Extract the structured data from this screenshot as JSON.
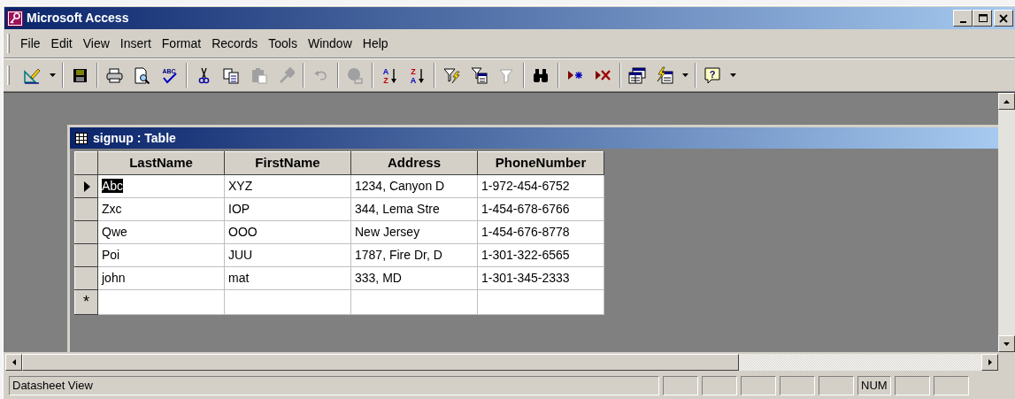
{
  "window": {
    "title": "Microsoft Access"
  },
  "menu": [
    {
      "label": "File"
    },
    {
      "label": "Edit"
    },
    {
      "label": "View"
    },
    {
      "label": "Insert"
    },
    {
      "label": "Format"
    },
    {
      "label": "Records"
    },
    {
      "label": "Tools"
    },
    {
      "label": "Window"
    },
    {
      "label": "Help"
    }
  ],
  "toolbar": {
    "groups": [
      [
        {
          "kind": "view",
          "disabled": false,
          "dropdown": true
        }
      ],
      [
        {
          "kind": "save",
          "disabled": false,
          "dropdown": false
        }
      ],
      [
        {
          "kind": "print",
          "disabled": false,
          "dropdown": false
        },
        {
          "kind": "preview",
          "disabled": false,
          "dropdown": false
        },
        {
          "kind": "spelling",
          "disabled": false,
          "dropdown": false,
          "glyphs": [
            "ABC"
          ]
        }
      ],
      [
        {
          "kind": "cut",
          "disabled": false,
          "dropdown": false
        },
        {
          "kind": "copy",
          "disabled": false,
          "dropdown": false
        },
        {
          "kind": "paste",
          "disabled": true,
          "dropdown": false
        },
        {
          "kind": "format_painter",
          "disabled": true,
          "dropdown": false
        }
      ],
      [
        {
          "kind": "undo",
          "disabled": true,
          "dropdown": false
        }
      ],
      [
        {
          "kind": "hyperlink",
          "disabled": true,
          "dropdown": false
        }
      ],
      [
        {
          "kind": "sort",
          "disabled": false,
          "dropdown": false,
          "glyphs": [
            "A",
            "Z"
          ]
        },
        {
          "kind": "sort",
          "disabled": false,
          "dropdown": false,
          "glyphs": [
            "Z",
            "A"
          ]
        }
      ],
      [
        {
          "kind": "filter_selection",
          "disabled": false,
          "dropdown": false
        },
        {
          "kind": "filter_form",
          "disabled": false,
          "dropdown": false
        },
        {
          "kind": "apply_filter",
          "disabled": true,
          "dropdown": false
        }
      ],
      [
        {
          "kind": "find",
          "disabled": false,
          "dropdown": false
        }
      ],
      [
        {
          "kind": "new_record",
          "disabled": false,
          "dropdown": false
        },
        {
          "kind": "delete_record",
          "disabled": false,
          "dropdown": false
        }
      ],
      [
        {
          "kind": "database_window",
          "disabled": false,
          "dropdown": false
        },
        {
          "kind": "new_object",
          "disabled": false,
          "dropdown": true
        }
      ],
      [
        {
          "kind": "help",
          "disabled": false,
          "dropdown": true,
          "glyphs": [
            "?"
          ]
        }
      ]
    ]
  },
  "table_window": {
    "title": "signup : Table",
    "columns": [
      "LastName",
      "FirstName",
      "Address",
      "PhoneNumber"
    ],
    "rows": [
      {
        "current": true,
        "cells": [
          "Abc",
          "XYZ",
          "1234, Canyon D",
          "1-972-454-6752"
        ]
      },
      {
        "current": false,
        "cells": [
          "Zxc",
          "IOP",
          "344, Lema Stre",
          "1-454-678-6766"
        ]
      },
      {
        "current": false,
        "cells": [
          "Qwe",
          "OOO",
          "New Jersey",
          "1-454-676-8778"
        ]
      },
      {
        "current": false,
        "cells": [
          "Poi",
          "JUU",
          "1787, Fire Dr, D",
          "1-301-322-6565"
        ]
      },
      {
        "current": false,
        "cells": [
          "john",
          "mat",
          "333, MD",
          "1-301-345-2333"
        ]
      }
    ],
    "new_record_marker": "*"
  },
  "status_bar": {
    "message": "Datasheet View",
    "num_lock": "NUM"
  }
}
